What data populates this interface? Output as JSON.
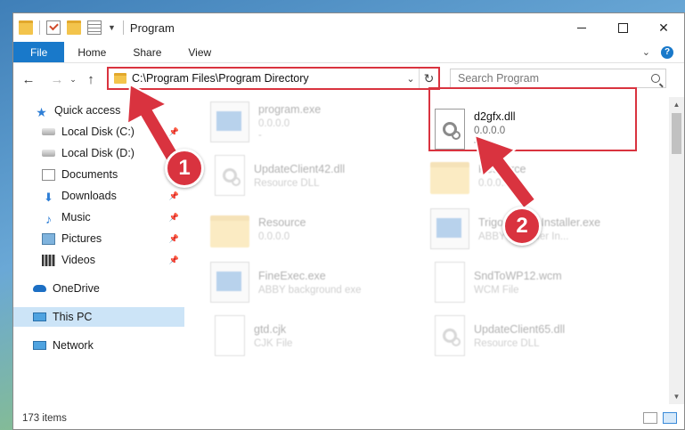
{
  "titlebar": {
    "title": "Program",
    "minimize": "",
    "maximize": "",
    "close": "✕"
  },
  "ribbon": {
    "tabs": [
      {
        "label": "File"
      },
      {
        "label": "Home"
      },
      {
        "label": "Share"
      },
      {
        "label": "View"
      }
    ]
  },
  "address": {
    "path": "C:\\Program Files\\Program Directory",
    "search_placeholder": "Search Program"
  },
  "nav": {
    "items": [
      {
        "label": "Quick access",
        "icon": "star-icon"
      },
      {
        "label": "Local Disk (C:)",
        "icon": "disk-icon"
      },
      {
        "label": "Local Disk (D:)",
        "icon": "disk-icon"
      },
      {
        "label": "Documents",
        "icon": "documents-icon"
      },
      {
        "label": "Downloads",
        "icon": "download-icon"
      },
      {
        "label": "Music",
        "icon": "music-icon"
      },
      {
        "label": "Pictures",
        "icon": "pictures-icon"
      },
      {
        "label": "Videos",
        "icon": "videos-icon"
      },
      {
        "label": "OneDrive",
        "icon": "cloud-icon"
      },
      {
        "label": "This PC",
        "icon": "computer-icon"
      },
      {
        "label": "Network",
        "icon": "network-icon"
      }
    ]
  },
  "files": [
    {
      "name": "program.exe",
      "line2": "0.0.0.0",
      "line3": "-"
    },
    {
      "name": "d2gfx.dll",
      "line2": "0.0.0.0",
      "line3": "-"
    },
    {
      "name": "UpdateClient42.dll",
      "line2": "Resource DLL",
      "line3": ""
    },
    {
      "name": "Resource",
      "line2": "0.0.0.0",
      "line3": ""
    },
    {
      "name": "Resource",
      "line2": "0.0.0.0",
      "line3": ""
    },
    {
      "name": "TrigonePriceInstaller.exe",
      "line2": "ABBYY Reader In...",
      "line3": ""
    },
    {
      "name": "FineExec.exe",
      "line2": "ABBY background exe",
      "line3": ""
    },
    {
      "name": "SndToWP12.wcm",
      "line2": "WCM File",
      "line3": ""
    },
    {
      "name": "gtd.cjk",
      "line2": "CJK File",
      "line3": ""
    },
    {
      "name": "UpdateClient65.dll",
      "line2": "Resource DLL",
      "line3": ""
    }
  ],
  "status": {
    "item_count": "173 items"
  },
  "annotations": {
    "step1": "1",
    "step2": "2"
  },
  "colors": {
    "accent": "#1979ca",
    "highlight": "#d9333f",
    "selected_nav": "#cce4f7"
  }
}
